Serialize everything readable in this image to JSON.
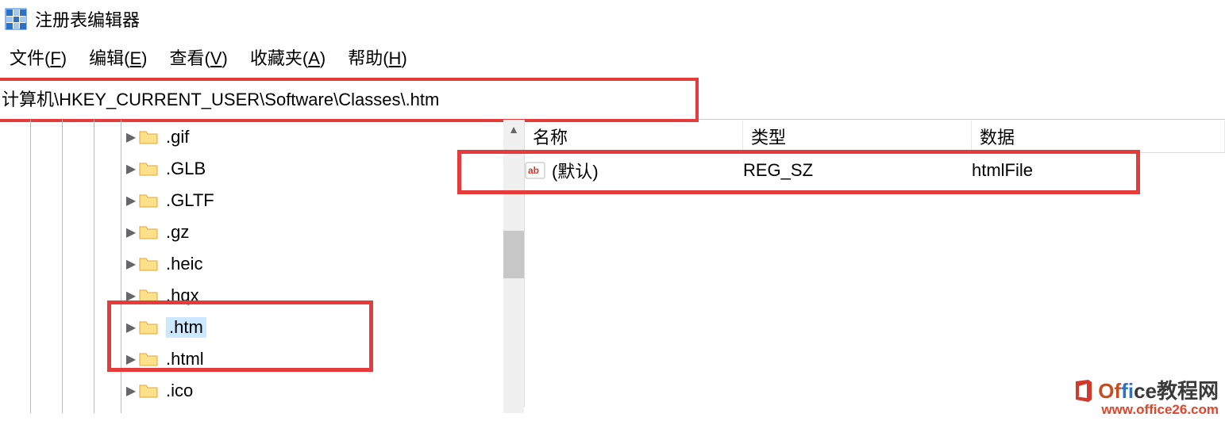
{
  "app": {
    "title": "注册表编辑器"
  },
  "menu": {
    "file": {
      "label": "文件",
      "accel": "F"
    },
    "edit": {
      "label": "编辑",
      "accel": "E"
    },
    "view": {
      "label": "查看",
      "accel": "V"
    },
    "fav": {
      "label": "收藏夹",
      "accel": "A"
    },
    "help": {
      "label": "帮助",
      "accel": "H"
    }
  },
  "address": "计算机\\HKEY_CURRENT_USER\\Software\\Classes\\.htm",
  "tree": {
    "items": [
      {
        "label": ".gif",
        "selected": false
      },
      {
        "label": ".GLB",
        "selected": false
      },
      {
        "label": ".GLTF",
        "selected": false
      },
      {
        "label": ".gz",
        "selected": false
      },
      {
        "label": ".heic",
        "selected": false
      },
      {
        "label": ".hqx",
        "selected": false
      },
      {
        "label": ".htm",
        "selected": true
      },
      {
        "label": ".html",
        "selected": false
      },
      {
        "label": ".ico",
        "selected": false
      }
    ]
  },
  "columns": {
    "name": "名称",
    "type": "类型",
    "data": "数据"
  },
  "values": [
    {
      "name": "(默认)",
      "type": "REG_SZ",
      "data": "htmlFile"
    }
  ],
  "watermark": {
    "line1a": "Of",
    "line1b": "fi",
    "line1c": "ce",
    "line1d": "教程网",
    "line2": "www.office26.com"
  }
}
